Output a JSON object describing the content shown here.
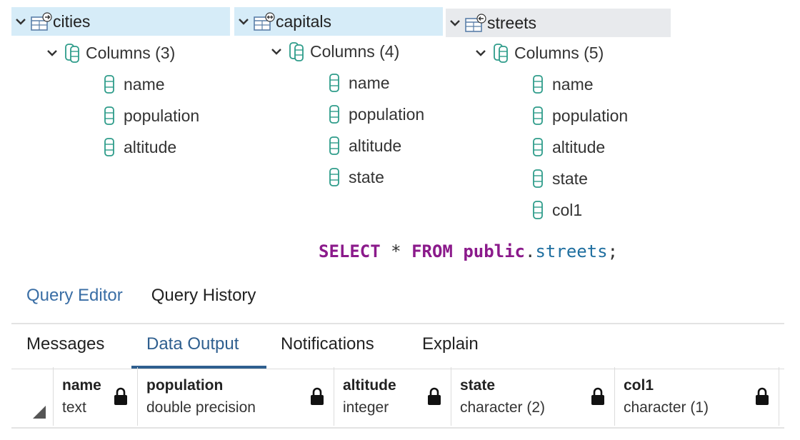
{
  "tree": {
    "tables": [
      {
        "name": "cities",
        "columns_label": "Columns (3)",
        "columns": [
          "name",
          "population",
          "altitude"
        ]
      },
      {
        "name": "capitals",
        "columns_label": "Columns (4)",
        "columns": [
          "name",
          "population",
          "altitude",
          "state"
        ]
      },
      {
        "name": "streets",
        "columns_label": "Columns (5)",
        "columns": [
          "name",
          "population",
          "altitude",
          "state",
          "col1"
        ]
      }
    ]
  },
  "sql": {
    "select": "SELECT",
    "star": " * ",
    "from": "FROM",
    "schema": "public",
    "dot": ".",
    "object": "streets",
    "semi": ";"
  },
  "editor_tabs": {
    "query_editor": "Query Editor",
    "query_history": "Query History"
  },
  "output_tabs": {
    "messages": "Messages",
    "data_output": "Data Output",
    "notifications": "Notifications",
    "explain": "Explain"
  },
  "grid": {
    "columns": [
      {
        "name": "name",
        "type": "text"
      },
      {
        "name": "population",
        "type": "double precision"
      },
      {
        "name": "altitude",
        "type": "integer"
      },
      {
        "name": "state",
        "type": "character (2)"
      },
      {
        "name": "col1",
        "type": "character (1)"
      }
    ]
  },
  "colors": {
    "header_highlight": "#d6ecf8",
    "header_gray": "#e8eaed",
    "column_icon": "#2e9c8a",
    "active_tab": "#2f5f8f",
    "keyword": "#8b1a8b",
    "object_name": "#1f6fa0"
  },
  "icons": {
    "chevron": "chevron-down-icon",
    "table": "table-icon",
    "columns": "columns-icon",
    "column": "column-icon",
    "lock": "lock-icon",
    "corner": "select-all-corner-icon"
  }
}
